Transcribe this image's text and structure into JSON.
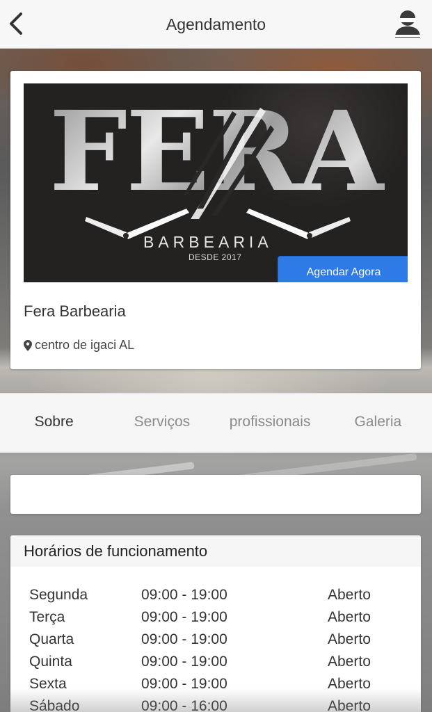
{
  "header": {
    "title": "Agendamento",
    "back_icon": "chevron-left-icon",
    "user_icon": "user-avatar-icon"
  },
  "shop": {
    "logo_main": "FERA",
    "logo_sub": "BARBEARIA",
    "logo_since": "DESDE 2017",
    "book_label": "Agendar Agora",
    "name": "Fera Barbearia",
    "location": "centro de igaci AL",
    "location_icon": "map-pin-icon",
    "accent_color": "#2e7be8"
  },
  "tabs": [
    {
      "label": "Sobre",
      "active": true
    },
    {
      "label": "Serviços",
      "active": false
    },
    {
      "label": "profissionais",
      "active": false
    },
    {
      "label": "Galeria",
      "active": false
    }
  ],
  "hours": {
    "title": "Horários de funcionamento",
    "rows": [
      {
        "day": "Segunda",
        "time": "09:00 - 19:00",
        "status": "Aberto"
      },
      {
        "day": "Terça",
        "time": "09:00 - 19:00",
        "status": "Aberto"
      },
      {
        "day": "Quarta",
        "time": "09:00 - 19:00",
        "status": "Aberto"
      },
      {
        "day": "Quinta",
        "time": "09:00 - 19:00",
        "status": "Aberto"
      },
      {
        "day": "Sexta",
        "time": "09:00 - 19:00",
        "status": "Aberto"
      },
      {
        "day": "Sábado",
        "time": "09:00 - 16:00",
        "status": "Aberto"
      }
    ]
  }
}
